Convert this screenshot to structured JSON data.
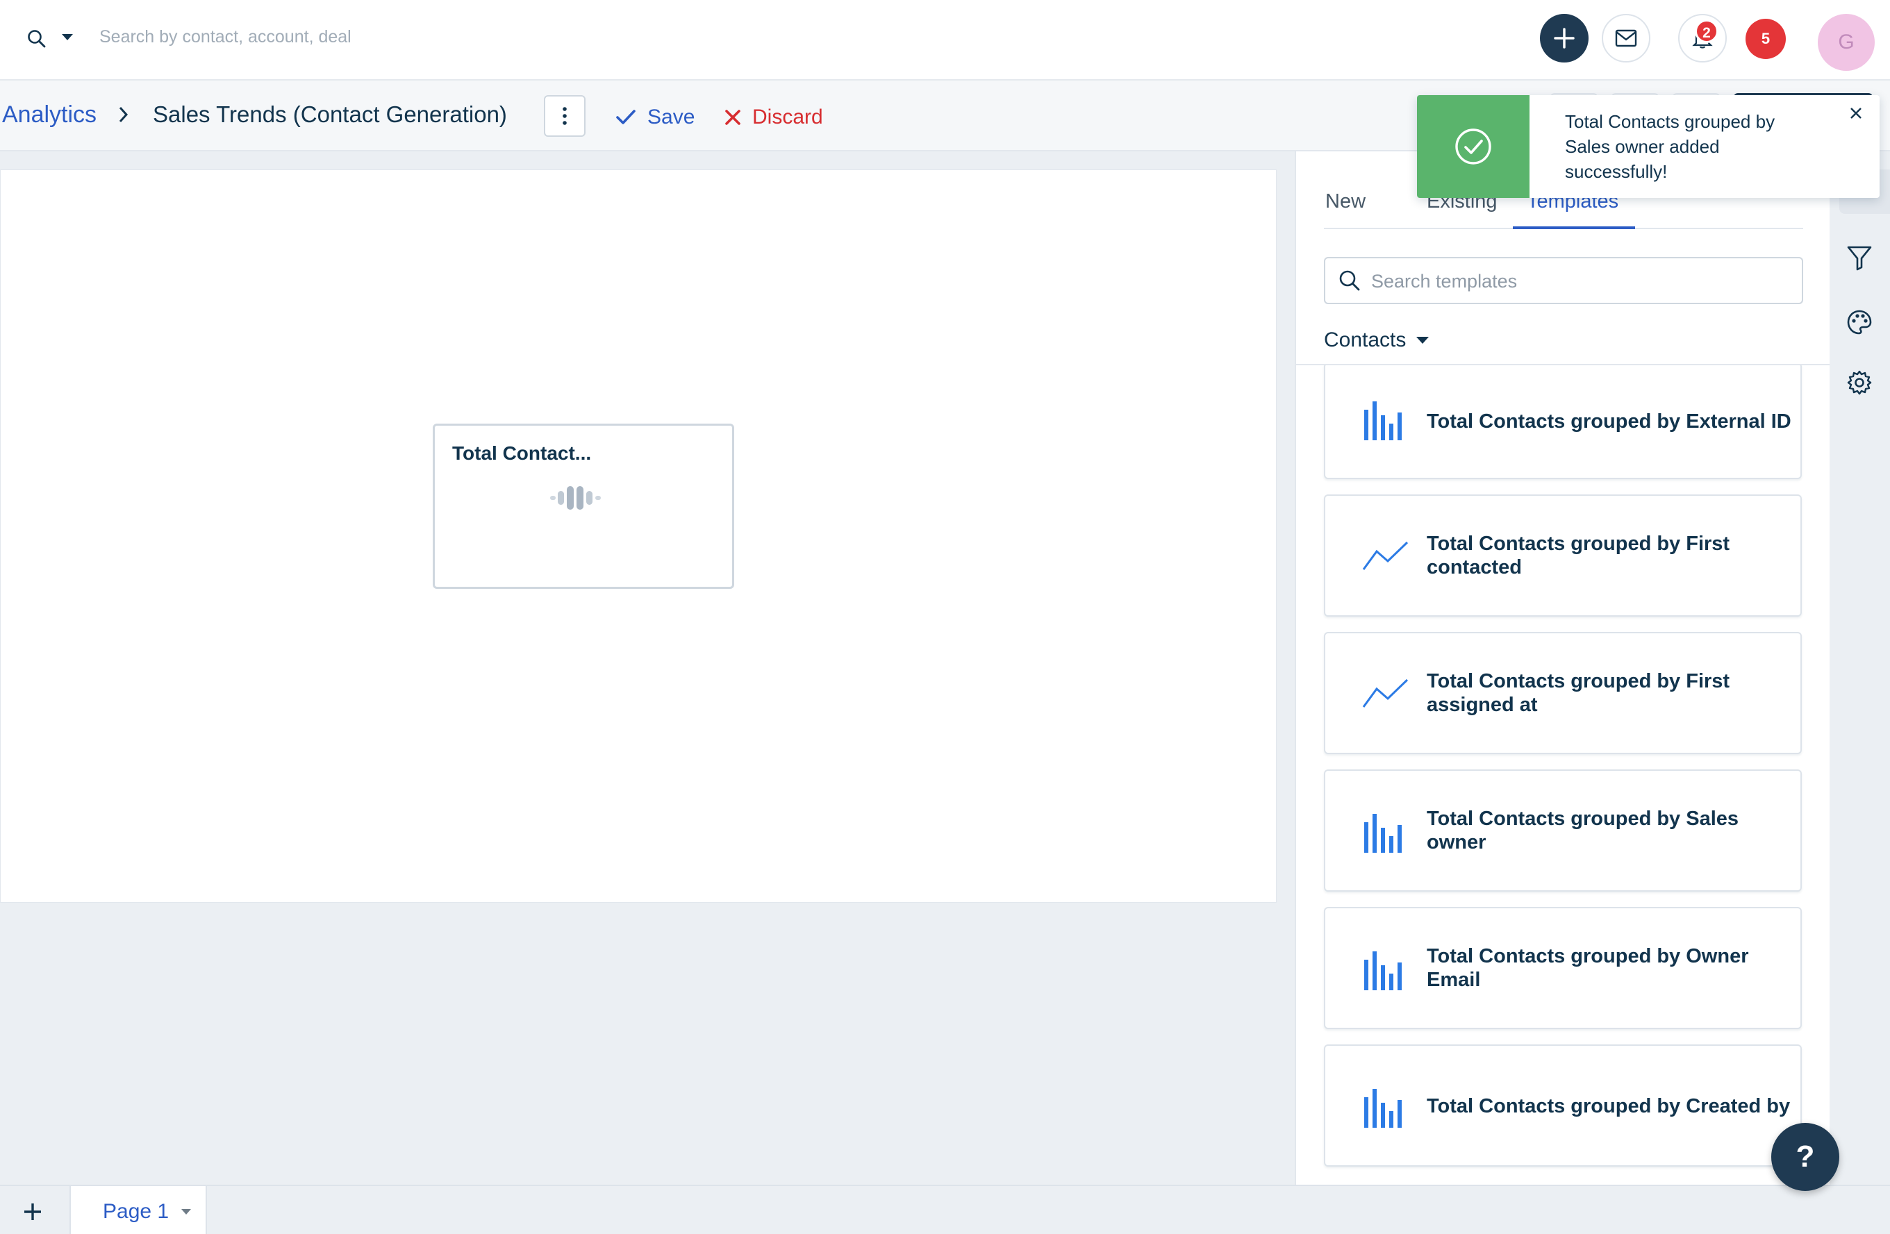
{
  "topbar": {
    "search_placeholder": "Search by contact, account, deal",
    "bell_badge": "2",
    "notification_count": "5",
    "avatar_initial": "G"
  },
  "header": {
    "breadcrumb": "Analytics",
    "title": "Sales Trends (Contact Generation)",
    "save_label": "Save",
    "discard_label": "Discard"
  },
  "canvas": {
    "widget_title": "Total Contact..."
  },
  "panel": {
    "tabs": [
      {
        "label": "New"
      },
      {
        "label": "Existing"
      },
      {
        "label": "Templates"
      }
    ],
    "search_placeholder": "Search templates",
    "entity": "Contacts",
    "templates": [
      {
        "label": "Total Contacts grouped by External ID",
        "icon": "bar-chart-icon"
      },
      {
        "label": "Total Contacts grouped by First contacted",
        "icon": "line-chart-icon"
      },
      {
        "label": "Total Contacts grouped by First assigned at",
        "icon": "line-chart-icon"
      },
      {
        "label": "Total Contacts grouped by Sales owner",
        "icon": "bar-chart-icon"
      },
      {
        "label": "Total Contacts grouped by Owner Email",
        "icon": "bar-chart-icon"
      },
      {
        "label": "Total Contacts grouped by Created by",
        "icon": "bar-chart-icon"
      }
    ]
  },
  "toast": {
    "message": "Total Contacts grouped by Sales owner added successfully!",
    "status_color": "#5ab46c"
  },
  "footer": {
    "page_tab": "Page 1"
  },
  "help": {
    "label": "?"
  },
  "colors": {
    "accent": "#2c5cc5",
    "danger": "#d72d30",
    "chart_icon": "#2c7be5",
    "navy": "#1f3a52"
  }
}
